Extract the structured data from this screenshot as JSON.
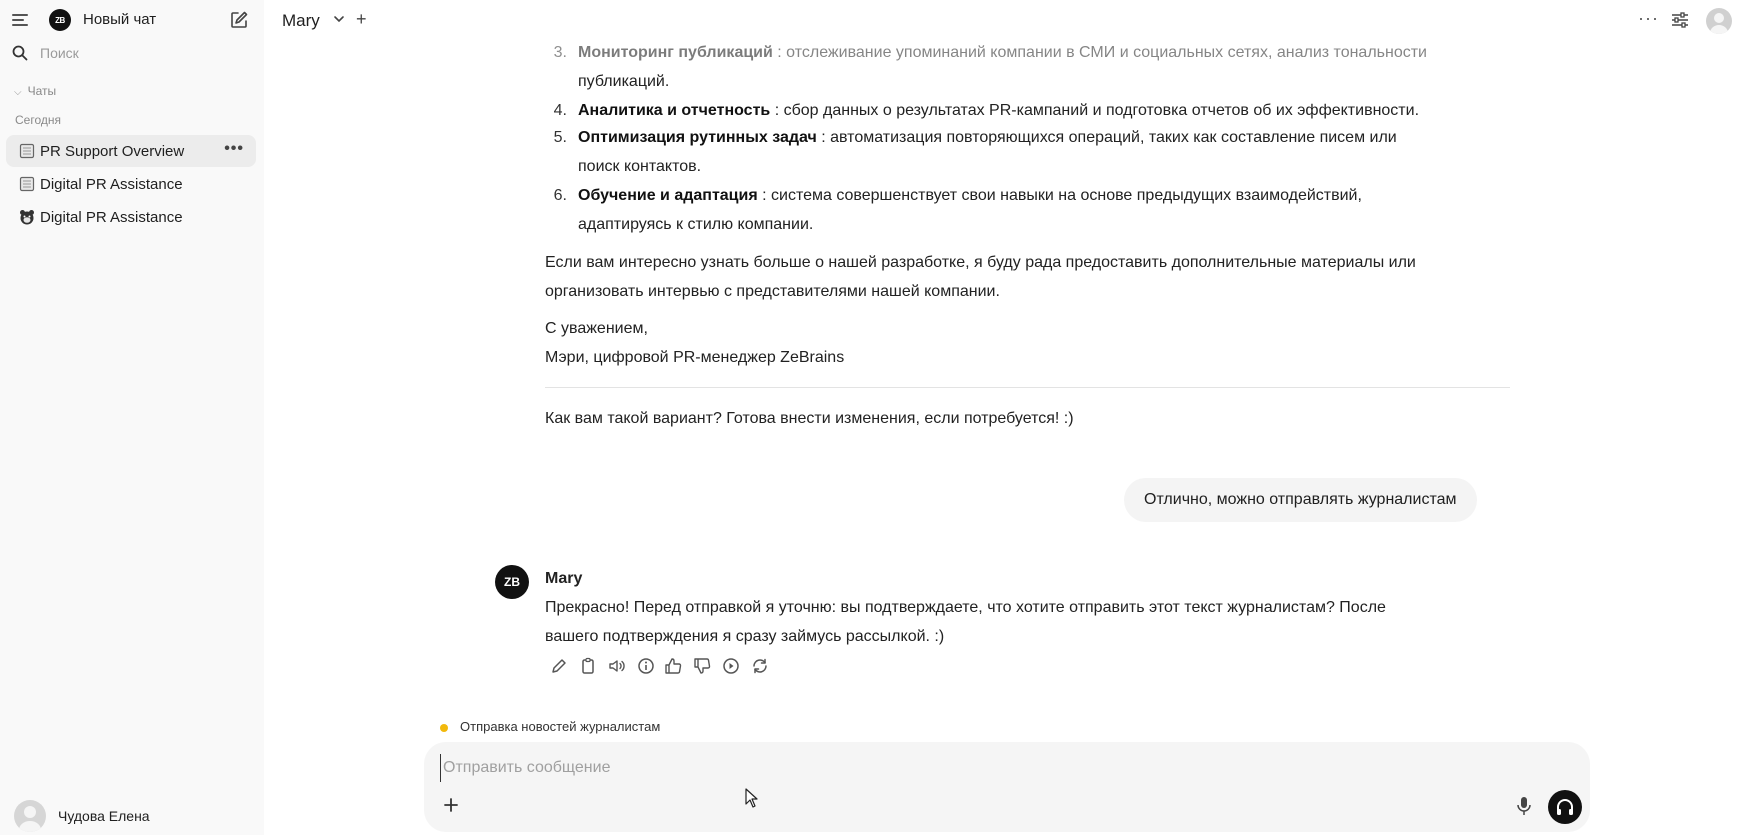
{
  "sidebar": {
    "new_chat": "Новый чат",
    "logo_text": "ZB",
    "search_placeholder": "Поиск",
    "section_label": "Чаты",
    "group_label": "Сегодня",
    "chats": [
      {
        "label": "PR Support Overview",
        "icon": "notebook-icon",
        "active": true,
        "more": "•••"
      },
      {
        "label": "Digital PR Assistance",
        "icon": "notebook-icon",
        "active": false
      },
      {
        "label": "Digital PR Assistance",
        "icon": "bear-face-icon",
        "active": false
      }
    ],
    "user_name": "Чудова Елена"
  },
  "header": {
    "model_name": "Mary",
    "add_label": "+",
    "more_label": "···"
  },
  "message": {
    "list_items": [
      {
        "num": "3.",
        "title": "Мониторинг публикаций",
        "text": " : отслеживание упоминаний компании в СМИ и социальных сетях, анализ тональности",
        "text_cont": "публикаций."
      },
      {
        "num": "4.",
        "title": "Аналитика и отчетность",
        "text": " : сбор данных о результатах PR-кампаний и подготовка отчетов об их эффективности."
      },
      {
        "num": "5.",
        "title": "Оптимизация рутинных задач",
        "text": " : автоматизация повторяющихся операций, таких как составление писем или",
        "text_cont": "поиск контактов."
      },
      {
        "num": "6.",
        "title": "Обучение и адаптация",
        "text": " : система совершенствует свои навыки на основе предыдущих взаимодействий,",
        "text_cont": "адаптируясь к стилю компании."
      }
    ],
    "para1_line1": "Если вам интересно узнать больше о нашей разработке, я буду рада предоставить дополнительные материалы или",
    "para1_line2": "организовать интервью с представителями нашей компании.",
    "sign_line1": "С уважением,",
    "sign_line2": "Мэри, цифровой PR-менеджер ZeBrains",
    "question": "Как вам такой вариант? Готова внести изменения, если потребуется! :)"
  },
  "user_message": "Отлично, можно отправлять журналистам",
  "bot_reply": {
    "avatar_text": "ZB",
    "name": "Mary",
    "line1": "Прекрасно! Перед отправкой я уточню: вы подтверждаете, что хотите отправить этот текст журналистам? После",
    "line2": "вашего подтверждения я сразу займусь рассылкой. :)"
  },
  "status": {
    "text": "Отправка новостей журналистам",
    "dot_color": "#f2b90c"
  },
  "composer": {
    "placeholder": "Отправить сообщение"
  }
}
